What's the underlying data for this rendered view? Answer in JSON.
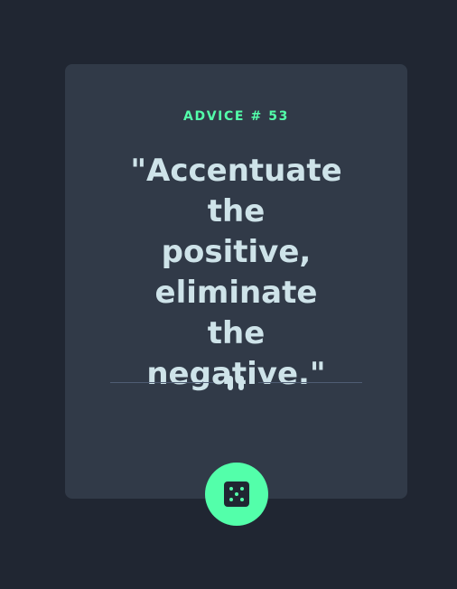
{
  "advice": {
    "label": "ADVICE # 53",
    "quote_lines": [
      "\"Accentuate",
      "the positive,",
      "eliminate",
      "the",
      "negative.\""
    ]
  },
  "colors": {
    "background": "#202632",
    "card": "#313A48",
    "accent": "#53FFAA",
    "text": "#CEE3E9",
    "divider": "#4F5D74"
  },
  "icons": {
    "divider": "pause-icon",
    "button": "dice-icon"
  }
}
